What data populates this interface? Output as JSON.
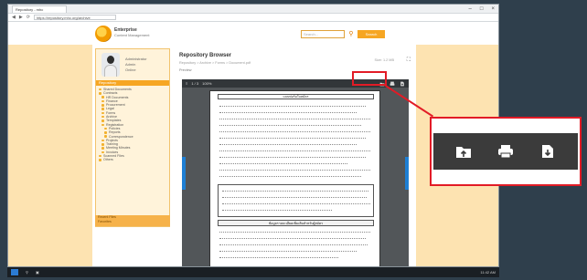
{
  "browser": {
    "tab_title": "Repository - mhc",
    "address": "https://repository.mhc.org/archive",
    "controls": [
      "–",
      "□",
      "×"
    ]
  },
  "header": {
    "brand_title": "Enterprise",
    "brand_sub": "Content Management",
    "search_placeholder": "Search...",
    "search_button": "Search"
  },
  "sidebar": {
    "user_name": "Administrator",
    "user_role": "Admin",
    "user_status": "Online",
    "nav_header": "Repository",
    "items": [
      "Shared Documents",
      "Contracts",
      "HR Documents",
      "Finance",
      "Procurement",
      "Legal",
      "Forms",
      "Archive",
      "Templates",
      "Registration",
      "Policies",
      "Reports",
      "Correspondence",
      "Projects",
      "Training",
      "Meeting Minutes",
      "Invoices",
      "Scanned Files",
      "Others"
    ],
    "footer_1": "Recent Files",
    "footer_2": "Favorites"
  },
  "main": {
    "title": "Repository Browser",
    "breadcrumb": "Repository > Archive > Forms > Document.pdf",
    "meta": "Size: 1.2 MB",
    "sublabel": "Preview"
  },
  "viewer": {
    "page_info": "1 / 3",
    "zoom": "100%",
    "doc_header": "แบบฟอร์มใบสมัคร",
    "section3": "ข้อมูลรายละเอียดเพิ่มเติมสำหรับผู้สมัคร"
  },
  "callout": {
    "icons": [
      "upload-folder-icon",
      "print-icon",
      "download-icon"
    ]
  },
  "taskbar": {
    "time": "11:42 AM"
  },
  "colors": {
    "accent": "#f6a623",
    "highlight": "#e21b26",
    "toolbar": "#3b3b3b"
  }
}
